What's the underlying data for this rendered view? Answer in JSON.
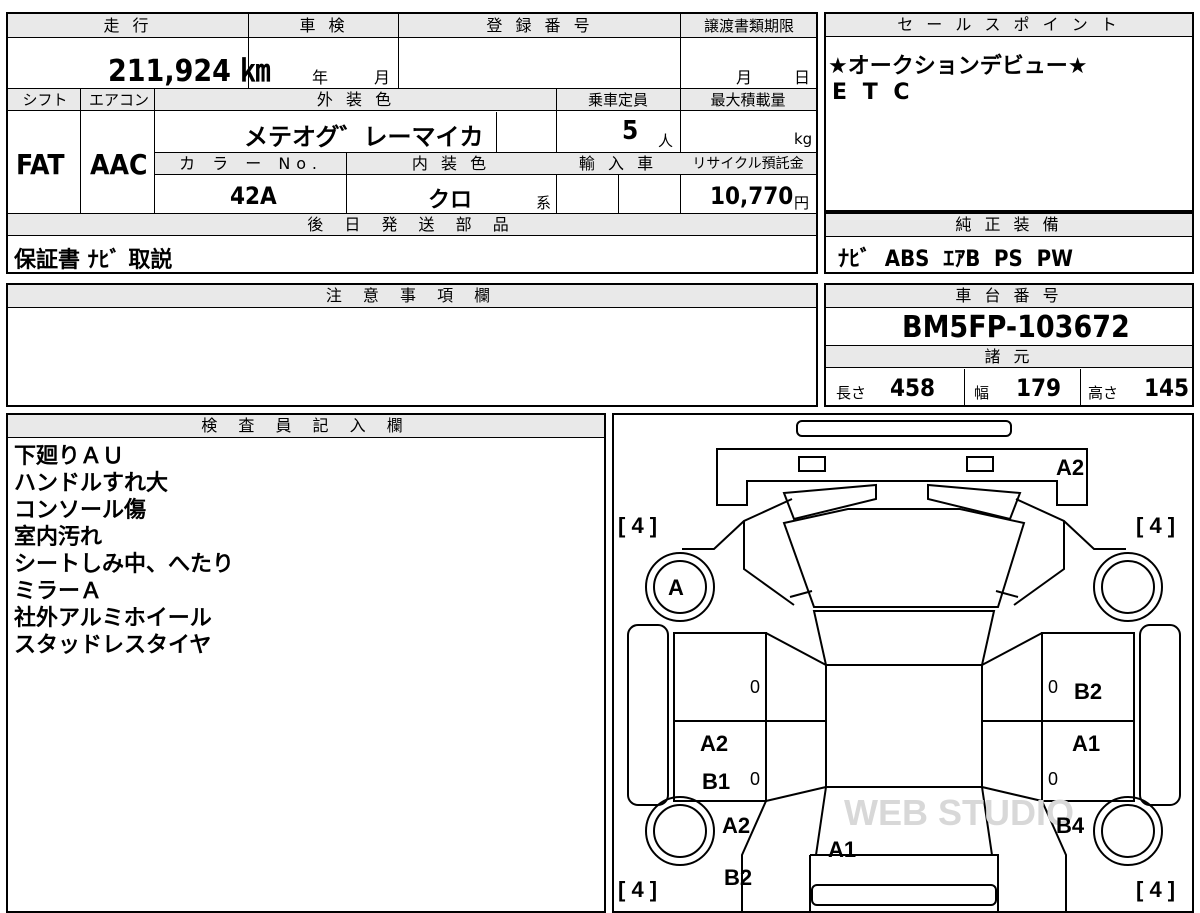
{
  "header": {
    "mileage_label": "走 行",
    "mileage_value": "211,924 ㎞",
    "inspection_label": "車 検",
    "inspection_year": "年",
    "inspection_month": "月",
    "registration_label": "登 録 番 号",
    "transfer_label": "譲渡書類期限",
    "transfer_month": "月",
    "transfer_day": "日"
  },
  "specs": {
    "shift_label": "シフト",
    "shift_value": "FAT",
    "ac_label": "エアコン",
    "ac_value": "AAC",
    "exterior_label": "外 装 色",
    "exterior_value": "メテオグ゛レーマイカ",
    "capacity_label": "乗車定員",
    "capacity_value": "5",
    "capacity_unit": "人",
    "load_label": "最大積載量",
    "load_unit": "kg",
    "color_no_label": "カ ラ ー No.",
    "color_no_value": "42A",
    "interior_label": "内 装 色",
    "interior_value": "クロ",
    "interior_suffix": "系",
    "import_label": "輸 入 車",
    "recycle_label": "リサイクル預託金",
    "recycle_value": "10,770",
    "recycle_unit": "円"
  },
  "parts": {
    "label": "後 日 発 送 部 品",
    "value": "保証書 ﾅﾋﾞ 取説"
  },
  "sales": {
    "label": "セ ー ル ス ポ イ ン ト",
    "line1": "★オークションデビュー★",
    "line2": "E T C"
  },
  "equipment": {
    "label": "純 正 装 備",
    "value": "ﾅﾋﾞ  ABS  ｴｱB  PS  PW"
  },
  "caution": {
    "label": "注 意 事 項 欄"
  },
  "chassis": {
    "label": "車 台 番 号",
    "value": "BM5FP-103672"
  },
  "dimensions": {
    "label": "諸 元",
    "length_label": "長さ",
    "length_value": "458",
    "width_label": "幅",
    "width_value": "179",
    "height_label": "高さ",
    "height_value": "145"
  },
  "inspector": {
    "label": "検 査 員 記 入 欄",
    "notes": [
      "下廻りＡＵ",
      "ハンドルすれ大",
      "コンソール傷",
      "室内汚れ",
      "シートしみ中、へたり",
      "ミラーＡ",
      "社外アルミホイール",
      "スタッドレスタイヤ"
    ]
  },
  "diagram": {
    "tire_front_left": "[ 4 ]",
    "tire_front_right": "[ 4 ]",
    "tire_rear_left": "[ 4 ]",
    "tire_rear_right": "[ 4 ]",
    "marks": [
      "A2",
      "A",
      "0",
      "0",
      "B2",
      "A2",
      "A1",
      "B1",
      "0",
      "0",
      "A2",
      "B4",
      "A1",
      "B2"
    ]
  },
  "watermark": "WEB STUDIO"
}
